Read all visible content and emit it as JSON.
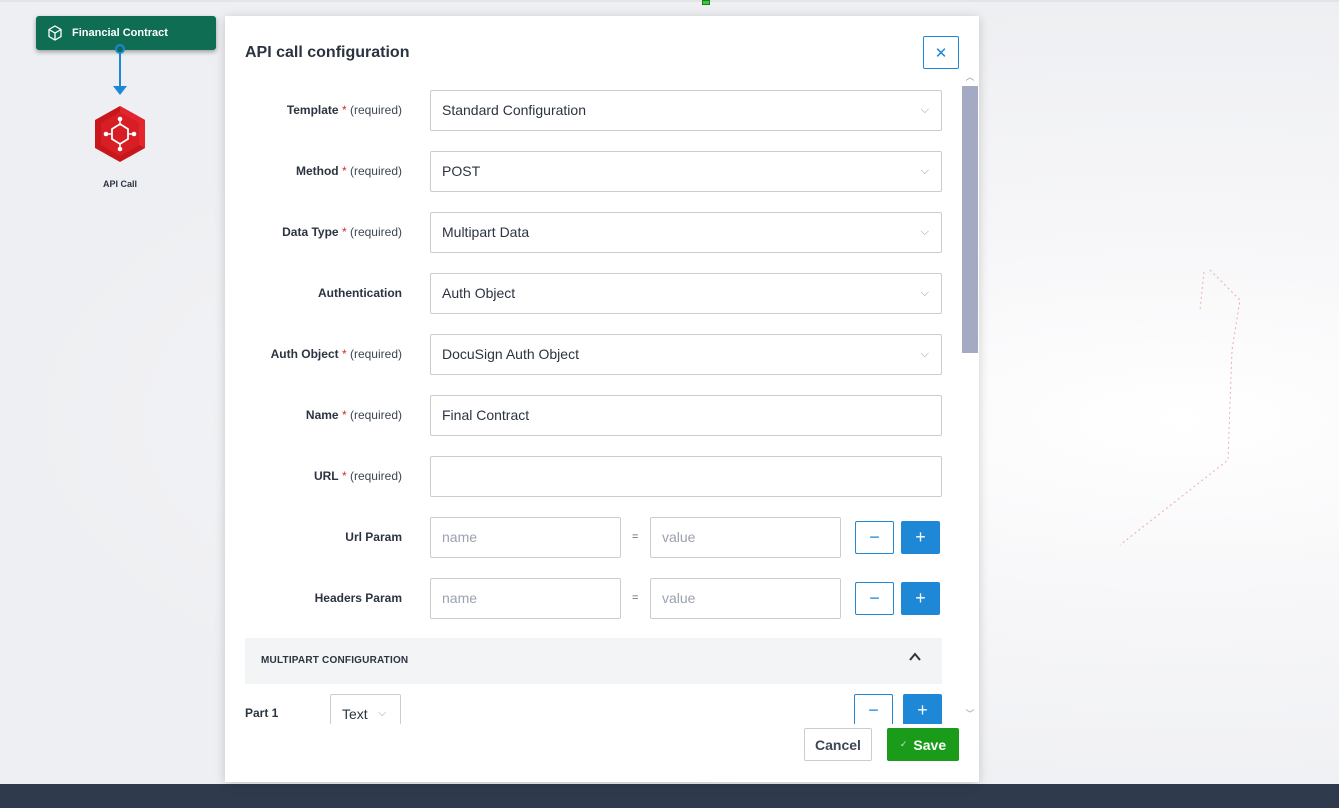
{
  "flow": {
    "source_node": {
      "label": "Financial Contract",
      "icon": "cube-icon"
    },
    "target_node": {
      "label": "API Call",
      "icon": "api-hexagon-icon"
    }
  },
  "modal": {
    "title": "API call configuration",
    "close_icon": "close-icon",
    "required_text": "(required)",
    "fields": {
      "template": {
        "label": "Template",
        "value": "Standard Configuration",
        "required": true
      },
      "method": {
        "label": "Method",
        "value": "POST",
        "required": true
      },
      "data_type": {
        "label": "Data Type",
        "value": "Multipart Data",
        "required": true
      },
      "authentication": {
        "label": "Authentication",
        "value": "Auth Object",
        "required": false
      },
      "auth_object": {
        "label": "Auth Object",
        "value": "DocuSign Auth Object",
        "required": true
      },
      "name": {
        "label": "Name",
        "value": "Final Contract",
        "required": true
      },
      "url": {
        "label": "URL",
        "value": "",
        "required": true
      }
    },
    "params": {
      "url_param": {
        "label": "Url Param",
        "name_placeholder": "name",
        "value_placeholder": "value",
        "equals": "="
      },
      "headers_param": {
        "label": "Headers Param",
        "name_placeholder": "name",
        "value_placeholder": "value",
        "equals": "="
      }
    },
    "multipart": {
      "title": "MULTIPART CONFIGURATION",
      "part_label": "Part 1",
      "part_type": "Text"
    },
    "buttons": {
      "minus": "−",
      "plus": "+",
      "cancel": "Cancel",
      "save": "Save"
    }
  },
  "colors": {
    "accent": "#1e88d6",
    "node_green": "#0e6d52",
    "save_green": "#1a9c1a",
    "required_star": "#d62a2a",
    "bottom_bar": "#2f3b4d"
  }
}
